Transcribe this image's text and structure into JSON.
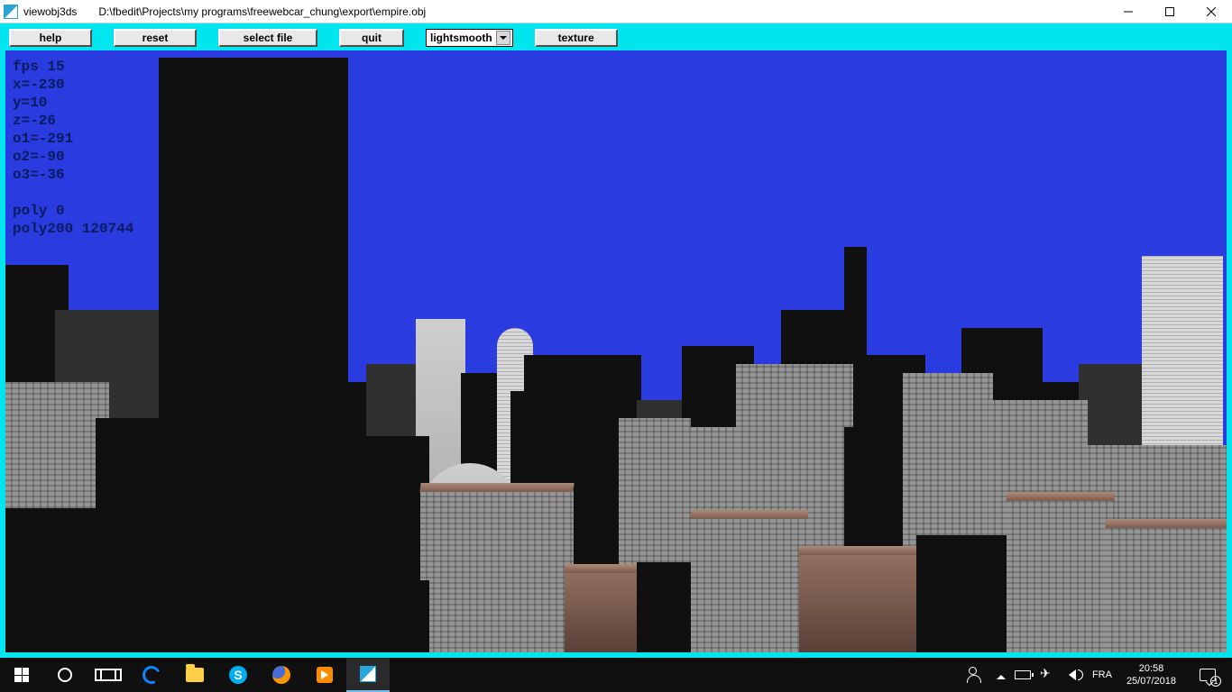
{
  "window": {
    "app_name": "viewobj3ds",
    "file_path": "D:\\fbedit\\Projects\\my programs\\freewebcar_chung\\export\\empire.obj"
  },
  "toolbar": {
    "help": "help",
    "reset": "reset",
    "select_file": "select file",
    "quit": "quit",
    "render_mode": "lightsmooth",
    "texture": "texture"
  },
  "hud": {
    "fps_label": "fps 15",
    "x": "x=-230",
    "y": "y=10",
    "z": "z=-26",
    "o1": "o1=-291",
    "o2": "o2=-90",
    "o3": "o3=-36",
    "poly0": "poly 0",
    "poly200": "poly200 120744"
  },
  "taskbar": {
    "lang": "FRA",
    "time": "20:58",
    "date": "25/07/2018",
    "notif_count": "1"
  }
}
